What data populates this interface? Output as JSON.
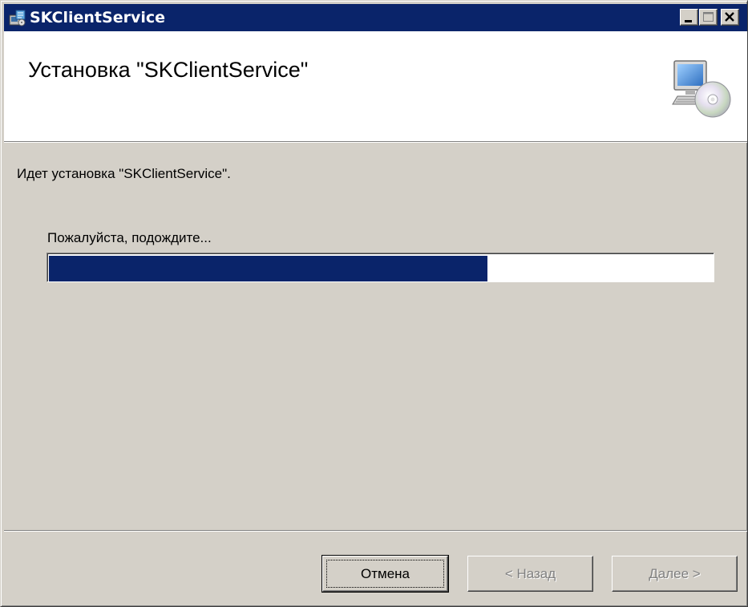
{
  "window": {
    "title": "SKClientService"
  },
  "header": {
    "title": "Установка \"SKClientService\""
  },
  "body": {
    "status_text": "Идет установка \"SKClientService\".",
    "wait_label": "Пожалуйста, подождите...",
    "progress_percent": 66
  },
  "buttons": {
    "cancel_label": "Отмена",
    "back_label": "< Назад",
    "next_label": "Далее >"
  },
  "colors": {
    "titlebar": "#0a246a",
    "progress_fill": "#0a246a",
    "dialog_bg": "#d4d0c8"
  },
  "icons": {
    "title_icon": "installer-icon",
    "header_icon": "computer-cd-icon"
  }
}
